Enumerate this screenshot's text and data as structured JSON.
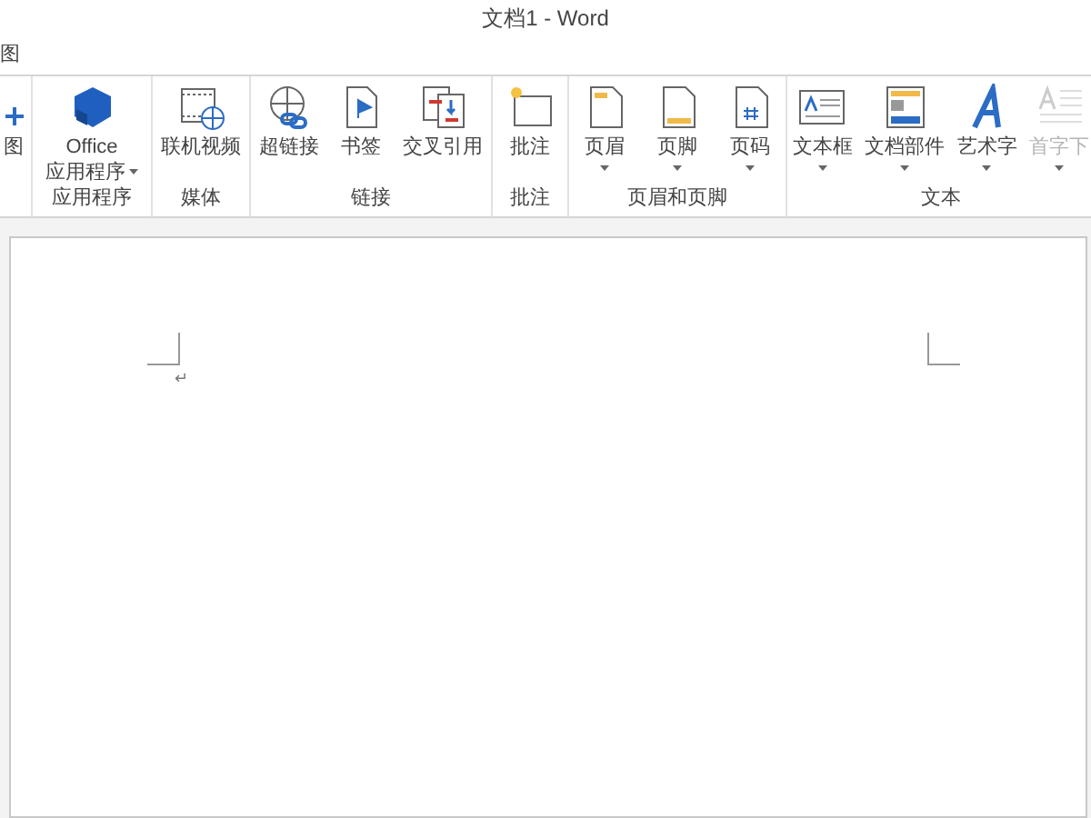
{
  "window": {
    "title": "文档1 - Word"
  },
  "tabs": [
    {
      "label": "图",
      "selected": false
    }
  ],
  "ribbon": {
    "groups": [
      {
        "buttons": [
          {
            "kind": "plus",
            "label": "图",
            "dropdown": false,
            "disabled": false
          }
        ]
      },
      {
        "label": "应用程序",
        "buttons": [
          {
            "kind": "office",
            "label": "Office",
            "label_2": "应用程序",
            "dropdown": true,
            "disabled": false
          }
        ]
      },
      {
        "label": "媒体",
        "buttons": [
          {
            "kind": "video",
            "label": "联机视频",
            "dropdown": false,
            "disabled": false
          }
        ]
      },
      {
        "label": "链接",
        "buttons": [
          {
            "kind": "link",
            "label": "超链接",
            "dropdown": false,
            "disabled": false
          },
          {
            "kind": "bookmark",
            "label": "书签",
            "dropdown": false,
            "disabled": false
          },
          {
            "kind": "crossref",
            "label": "交叉引用",
            "dropdown": false,
            "disabled": false
          }
        ]
      },
      {
        "label": "批注",
        "buttons": [
          {
            "kind": "comment",
            "label": "批注",
            "dropdown": false,
            "disabled": false
          }
        ]
      },
      {
        "label": "页眉和页脚",
        "buttons": [
          {
            "kind": "header",
            "label": "页眉",
            "dropdown": true,
            "disabled": false
          },
          {
            "kind": "footer",
            "label": "页脚",
            "dropdown": true,
            "disabled": false
          },
          {
            "kind": "pagenum",
            "label": "页码",
            "dropdown": true,
            "disabled": false
          }
        ]
      },
      {
        "label": "文本",
        "buttons": [
          {
            "kind": "textbox",
            "label": "文本框",
            "dropdown": true,
            "disabled": false
          },
          {
            "kind": "parts",
            "label": "文档部件",
            "dropdown": true,
            "disabled": false
          },
          {
            "kind": "wordart",
            "label": "艺术字",
            "dropdown": true,
            "disabled": false
          },
          {
            "kind": "dropcap",
            "label": "首字下",
            "dropdown": true,
            "disabled": true
          }
        ]
      }
    ]
  },
  "document": {
    "paragraph_mark": "↵"
  }
}
